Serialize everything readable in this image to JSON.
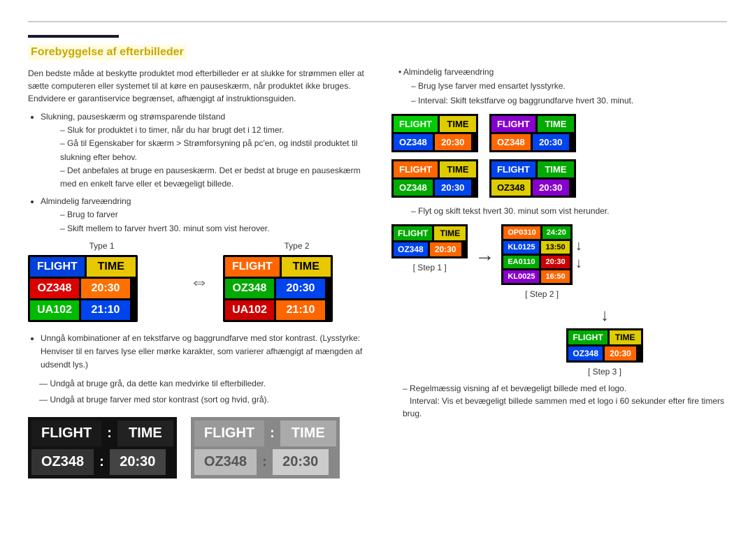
{
  "page": {
    "top_rule": true,
    "title": "Forebyggelse af efterbilleder",
    "left_accent": true
  },
  "left": {
    "intro_text": "Den bedste måde at beskytte produktet mod efterbilleder er at slukke for strømmen eller at sætte computeren eller systemet til at køre en pauseskærm, når produktet ikke bruges. Endvidere er garantiservice begrænset, afhængigt af instruktionsguiden.",
    "bullets": [
      {
        "text": "Slukning, pauseskærm og strømsparende tilstand",
        "dashes": [
          "Sluk for produktet i to timer, når du har brugt det i 12 timer.",
          "Gå til Egenskaber for skærm > Strømforsyning på pc'en, og indstil produktet til slukning efter behov.",
          "Det anbefales at bruge en pauseskærm. Det er bedst at bruge en pauseskærm med en enkelt farve eller et bevægeligt billede."
        ]
      },
      {
        "text": "Almindelig farveændring",
        "dashes": [
          "Brug to farver",
          "Skift mellem to farver hvert 30. minut som vist herover."
        ]
      }
    ],
    "type1_label": "Type 1",
    "type2_label": "Type 2",
    "boards": {
      "t1": {
        "rows": [
          [
            {
              "text": "FLIGHT",
              "color": "blue"
            },
            {
              "text": "TIME",
              "color": "yellow_dark"
            }
          ],
          [
            {
              "text": "OZ348",
              "color": "red"
            },
            {
              "text": "20:30",
              "color": "orange"
            }
          ],
          [
            {
              "text": "UA102",
              "color": "green"
            },
            {
              "text": "21:10",
              "color": "blue2"
            }
          ]
        ]
      },
      "t2": {
        "rows": [
          [
            {
              "text": "FLIGHT",
              "color": "orange"
            },
            {
              "text": "TIME",
              "color": "yellow_dark"
            }
          ],
          [
            {
              "text": "OZ348",
              "color": "green"
            },
            {
              "text": "20:30",
              "color": "blue2"
            }
          ],
          [
            {
              "text": "UA102",
              "color": "red"
            },
            {
              "text": "21:10",
              "color": "orange"
            }
          ]
        ]
      }
    },
    "avoid_text": "Unngå kombinationer af en tekstfarve og baggrundfarve med stor kontrast. (Lysstyrke: Henviser til en farves lyse eller mørke karakter, som varierer afhængigt af mængden af udsendt lys.)",
    "dash1": "Undgå at bruge grå, da dette kan medvirke til efterbilleder.",
    "dash2": "Undgå at bruge farver med stor kontrast (sort og hvid, grå).",
    "bad_boards": {
      "board1_label": "",
      "board2_label": "",
      "board1": {
        "header": [
          "FLIGHT",
          "TIME"
        ],
        "row2": [
          "OZ348",
          "20:30"
        ]
      },
      "board2": {
        "header": [
          "FLIGHT",
          "TIME"
        ],
        "row2": [
          "OZ348",
          "20:30"
        ]
      }
    }
  },
  "right": {
    "bullet1": "Almindelig farveændring",
    "dash1": "Brug lyse farver med ensartet lysstyrke.",
    "dash1b": "Interval: Skift tekstfarve og baggrundfarve hvert 30. minut.",
    "color_boards": {
      "board1": {
        "bg": "green",
        "rows": [
          [
            {
              "text": "FLIGHT",
              "color": "green_cell"
            },
            {
              "text": "TIME",
              "color": "yellow_cell"
            }
          ],
          [
            {
              "text": "OZ348",
              "color": "blue_cell"
            },
            {
              "text": "20:30",
              "color": "orange_cell"
            }
          ]
        ]
      },
      "board2": {
        "bg": "purple",
        "rows": [
          [
            {
              "text": "FLIGHT",
              "color": "purple_cell"
            },
            {
              "text": "TIME",
              "color": "green_cell2"
            }
          ],
          [
            {
              "text": "OZ348",
              "color": "orange_cell2"
            },
            {
              "text": "20:30",
              "color": "blue_cell2"
            }
          ]
        ]
      },
      "board3": {
        "rows": [
          [
            {
              "text": "FLIGHT",
              "color": "orange_h"
            },
            {
              "text": "TIME",
              "color": "yellow_h"
            }
          ],
          [
            {
              "text": "OZ348",
              "color": "green_h"
            },
            {
              "text": "20:30",
              "color": "blue_h"
            }
          ]
        ]
      },
      "board4": {
        "rows": [
          [
            {
              "text": "FLIGHT",
              "color": "blue_h2"
            },
            {
              "text": "TIME",
              "color": "green_h2"
            }
          ],
          [
            {
              "text": "OZ348",
              "color": "yellow_h2"
            },
            {
              "text": "20:30",
              "color": "purple_h2"
            }
          ]
        ]
      }
    },
    "scroll_dash": "Flyt og skift tekst hvert 30. minut som vist herunder.",
    "step1_label": "[ Step 1 ]",
    "step2_label": "[ Step 2 ]",
    "step3_label": "[ Step 3 ]",
    "step1_board": {
      "rows": [
        [
          {
            "text": "FLIGHT",
            "color": "green_s"
          },
          {
            "text": "TIME",
            "color": "yellow_s"
          }
        ],
        [
          {
            "text": "OZ348",
            "color": "blue_s"
          },
          {
            "text": "20:30",
            "color": "orange_s"
          }
        ]
      ]
    },
    "step2_board": {
      "rows": [
        [
          {
            "text": "OP0310",
            "color": "orange_sc"
          },
          {
            "text": "24:20",
            "color": "green_sc"
          }
        ],
        [
          {
            "text": "KL0125",
            "color": "blue_sc"
          },
          {
            "text": "13:50",
            "color": "yellow_sc"
          }
        ],
        [
          {
            "text": "EA0110",
            "color": "green_sc2"
          },
          {
            "text": "20:30",
            "color": "red_sc"
          }
        ],
        [
          {
            "text": "KL0025",
            "color": "purple_sc"
          },
          {
            "text": "16:50",
            "color": "orange_sc2"
          }
        ]
      ]
    },
    "step3_board": {
      "rows": [
        [
          {
            "text": "FLIGHT",
            "color": "green_s3"
          },
          {
            "text": "TIME",
            "color": "yellow_s3"
          }
        ],
        [
          {
            "text": "OZ348",
            "color": "blue_s3"
          },
          {
            "text": "20:30",
            "color": "orange_s3"
          }
        ]
      ]
    },
    "bottom_dash1": "Regelmæssig visning af et bevægeligt billede med et logo.",
    "bottom_dash1b": "Interval: Vis et bevægeligt billede sammen med et logo i 60 sekunder efter fire timers brug."
  }
}
